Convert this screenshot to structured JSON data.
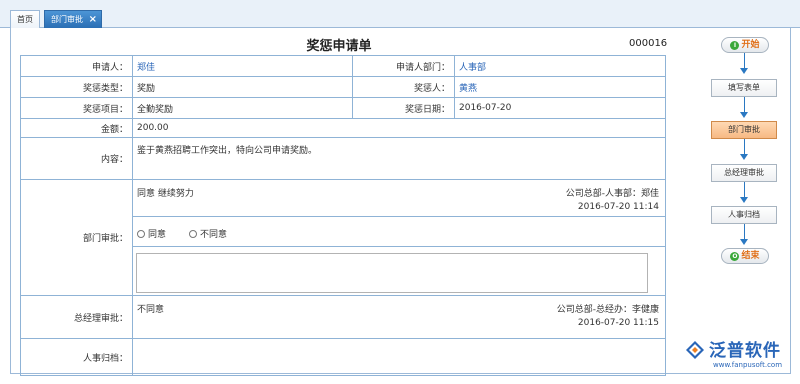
{
  "tabs": [
    {
      "label": "首页",
      "active": false
    },
    {
      "label": "部门审批",
      "active": true,
      "close_icon": "×"
    }
  ],
  "form": {
    "title": "奖惩申请单",
    "doc_no": "000016",
    "applicant_label": "申请人：",
    "applicant": "郑佳",
    "applicant_dept_label": "申请人部门：",
    "applicant_dept": "人事部",
    "type_label": "奖惩类型：",
    "type": "奖励",
    "target_label": "奖惩人：",
    "target": "黄燕",
    "item_label": "奖惩项目：",
    "item": "全勤奖励",
    "date_label": "奖惩日期：",
    "date": "2016-07-20",
    "amount_label": "金额：",
    "amount": "200.00",
    "content_label": "内容：",
    "content": "鉴于黄燕招聘工作突出，特向公司申请奖励。",
    "dept_approval_label": "部门审批：",
    "dept_opinion": "同意  继续努力",
    "dept_signer": "公司总部-人事部：郑佳",
    "dept_time": "2016-07-20 11:14",
    "radio_agree": "同意",
    "radio_disagree": "不同意",
    "textarea_value": "",
    "gm_approval_label": "总经理审批：",
    "gm_opinion": "不同意",
    "gm_signer": "公司总部-总经办：李健康",
    "gm_time": "2016-07-20 11:15",
    "hr_archive_label": "人事归档："
  },
  "flow": {
    "start": "开始",
    "steps": [
      "填写表单",
      "部门审批",
      "总经理审批",
      "人事归档"
    ],
    "active_step": "部门审批",
    "end": "结束"
  },
  "logo": {
    "name": "泛普软件",
    "url": "www.fanpusoft.com"
  },
  "colors": {
    "link": "#2a66b8",
    "border": "#8fb3d6",
    "active_step": "#f7b983",
    "flow_line": "#2a78c2"
  }
}
